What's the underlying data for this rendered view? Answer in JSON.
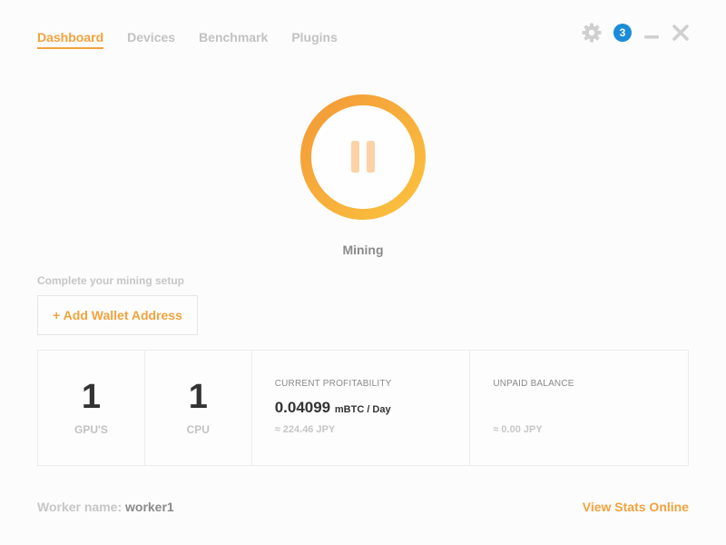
{
  "nav": {
    "tabs": [
      {
        "label": "Dashboard",
        "active": true
      },
      {
        "label": "Devices"
      },
      {
        "label": "Benchmark"
      },
      {
        "label": "Plugins"
      }
    ]
  },
  "window_controls": {
    "settings_icon": "gear-icon",
    "notification_count": "3",
    "minimize_icon": "minimize-icon",
    "close_icon": "close-icon"
  },
  "mining": {
    "toggle_icon": "pause-icon",
    "status": "Mining"
  },
  "setup": {
    "label": "Complete your mining setup",
    "wallet_button": "+ Add Wallet Address"
  },
  "stats": {
    "gpus": {
      "value": "1",
      "label": "GPU'S"
    },
    "cpus": {
      "value": "1",
      "label": "CPU"
    },
    "profitability": {
      "title": "CURRENT PROFITABILITY",
      "value": "0.04099",
      "unit": "mBTC / Day",
      "fiat": "≈ 224.46 JPY"
    },
    "balance": {
      "title": "UNPAID BALANCE",
      "fiat": "≈ 0.00 JPY"
    }
  },
  "footer": {
    "worker_label": "Worker name:",
    "worker_name": "worker1",
    "stats_link": "View Stats Online"
  },
  "colors": {
    "accent": "#f2a23d",
    "ring_start": "#f39a38",
    "ring_end": "#fbc23e",
    "badge": "#1b8cd8",
    "inactive_text": "#c2c2c2"
  }
}
